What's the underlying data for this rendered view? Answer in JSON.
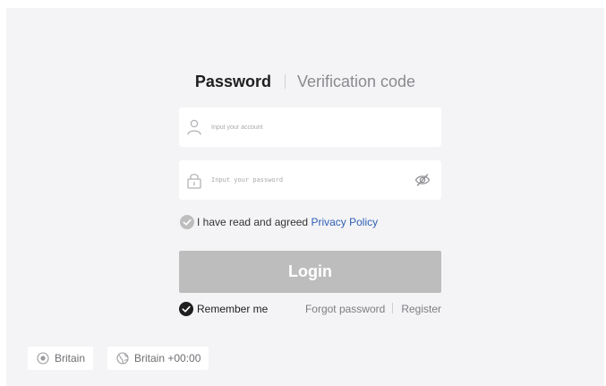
{
  "tabs": {
    "password_label": "Password",
    "verification_label": "Verification code"
  },
  "account": {
    "placeholder": "Input your account",
    "icon": "user-icon"
  },
  "password": {
    "placeholder": "Input your password",
    "icon": "lock-icon",
    "toggle_icon": "eye-hidden-icon"
  },
  "agreement": {
    "text": "I have read and agreed ",
    "link": "Privacy Policy",
    "checked": true
  },
  "login": {
    "label": "Login"
  },
  "options": {
    "remember_label": "Remember me",
    "remember_checked": true,
    "forgot_label": "Forgot password",
    "register_label": "Register"
  },
  "footer": {
    "region_label": "Britain",
    "region_icon": "location-icon",
    "timezone_label": "Britain +00:00",
    "timezone_icon": "globe-icon"
  },
  "colors": {
    "background": "#f4f4f6",
    "link": "#2f5fb3",
    "button_disabled": "#bdbdbd",
    "check_gray": "#bdbdbd",
    "check_dark": "#1f1f1f"
  }
}
